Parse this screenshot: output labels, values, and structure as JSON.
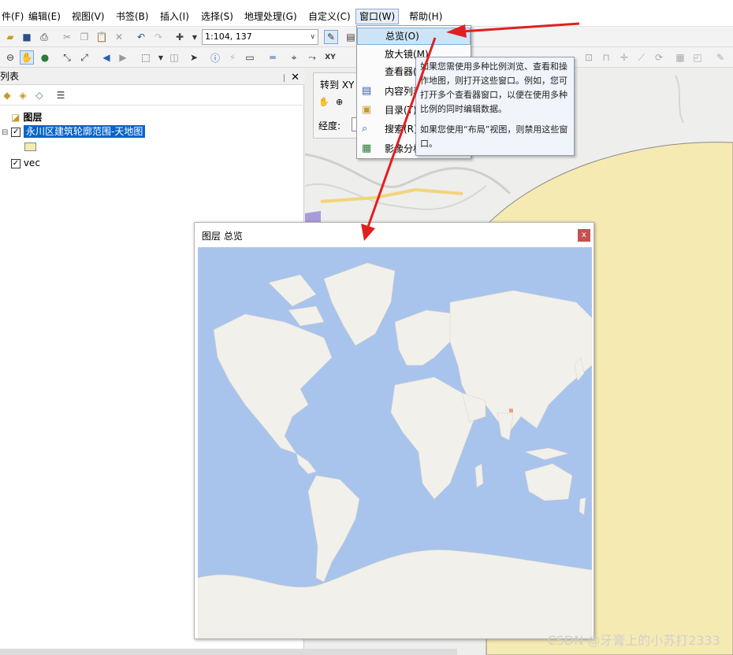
{
  "menubar": {
    "items": [
      "件(F)",
      "编辑(E)",
      "视图(V)",
      "书签(B)",
      "插入(I)",
      "选择(S)",
      "地理处理(G)",
      "自定义(C)",
      "窗口(W)",
      "帮助(H)"
    ]
  },
  "toolbar": {
    "scale_value": "1:104, 137"
  },
  "toc": {
    "title": "列表",
    "pin_glyph": "ᛁ",
    "close_glyph": "✕",
    "root_label": "图层",
    "layer1_label": "永川区建筑轮廓范围-天地图",
    "layer2_label": "vec"
  },
  "map_panel": {
    "goto_label": "转到 XY",
    "longitude_label": "经度:"
  },
  "window_menu": {
    "items": [
      "总览(O)",
      "放大镜(M)",
      "查看器(V)",
      "内容列表",
      "目录(T)",
      "搜索(R)",
      "影像分析"
    ]
  },
  "tooltip": {
    "paragraph1": "如果您需使用多种比例浏览、查看和操作地图，则打开这些窗口。例如，您可打开多个查看器窗口，以便在使用多种比例的同时编辑数据。",
    "paragraph2": "如果您使用“布局”视图，则禁用这些窗口。"
  },
  "overview": {
    "title": "图层 总览",
    "close_glyph": "x"
  },
  "watermark": "CSDN @牙膏上的小苏打2333",
  "colors": {
    "selection_blue": "#0a64c8",
    "arrow_red": "#e02020",
    "ocean": "#a9c4ec",
    "land": "#f2f0ea",
    "building_fill": "#f6eab3"
  }
}
